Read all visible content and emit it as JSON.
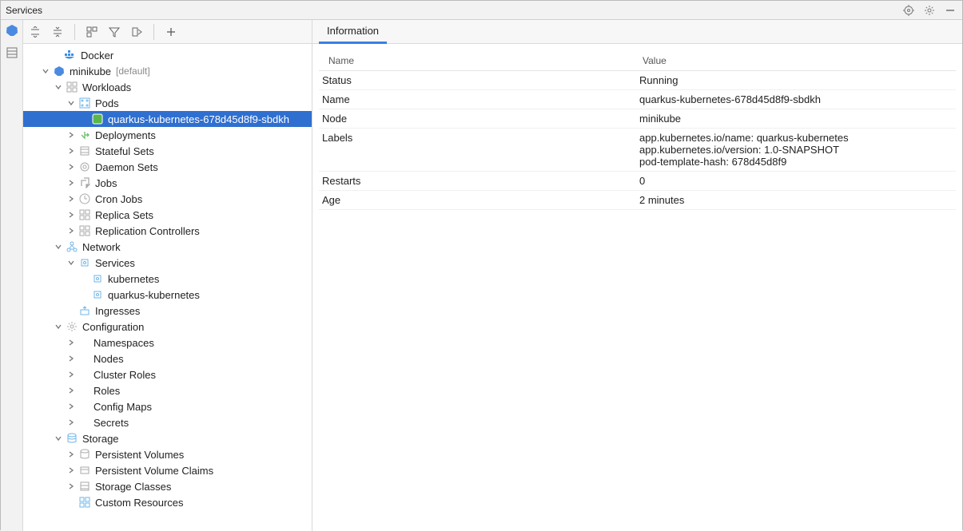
{
  "window": {
    "title": "Services"
  },
  "tree": {
    "docker": "Docker",
    "minikube": "minikube",
    "minikube_ctx": "[default]",
    "workloads": "Workloads",
    "pods": "Pods",
    "pod_1": "quarkus-kubernetes-678d45d8f9-sbdkh",
    "deployments": "Deployments",
    "stateful_sets": "Stateful Sets",
    "daemon_sets": "Daemon Sets",
    "jobs": "Jobs",
    "cron_jobs": "Cron Jobs",
    "replica_sets": "Replica Sets",
    "replication_controllers": "Replication Controllers",
    "network": "Network",
    "services": "Services",
    "svc_kubernetes": "kubernetes",
    "svc_quarkus": "quarkus-kubernetes",
    "ingresses": "Ingresses",
    "configuration": "Configuration",
    "namespaces": "Namespaces",
    "nodes": "Nodes",
    "cluster_roles": "Cluster Roles",
    "roles": "Roles",
    "config_maps": "Config Maps",
    "secrets": "Secrets",
    "storage": "Storage",
    "persistent_volumes": "Persistent Volumes",
    "persistent_volume_claims": "Persistent Volume Claims",
    "storage_classes": "Storage Classes",
    "custom_resources": "Custom Resources"
  },
  "info": {
    "tab": "Information",
    "col_name": "Name",
    "col_value": "Value",
    "rows": [
      {
        "name": "Status",
        "value": "Running"
      },
      {
        "name": "Name",
        "value": "quarkus-kubernetes-678d45d8f9-sbdkh"
      },
      {
        "name": "Node",
        "value": "minikube"
      },
      {
        "name": "Labels",
        "value": "app.kubernetes.io/name: quarkus-kubernetes\napp.kubernetes.io/version: 1.0-SNAPSHOT\npod-template-hash: 678d45d8f9"
      },
      {
        "name": "Restarts",
        "value": "0"
      },
      {
        "name": "Age",
        "value": "2 minutes"
      }
    ]
  }
}
